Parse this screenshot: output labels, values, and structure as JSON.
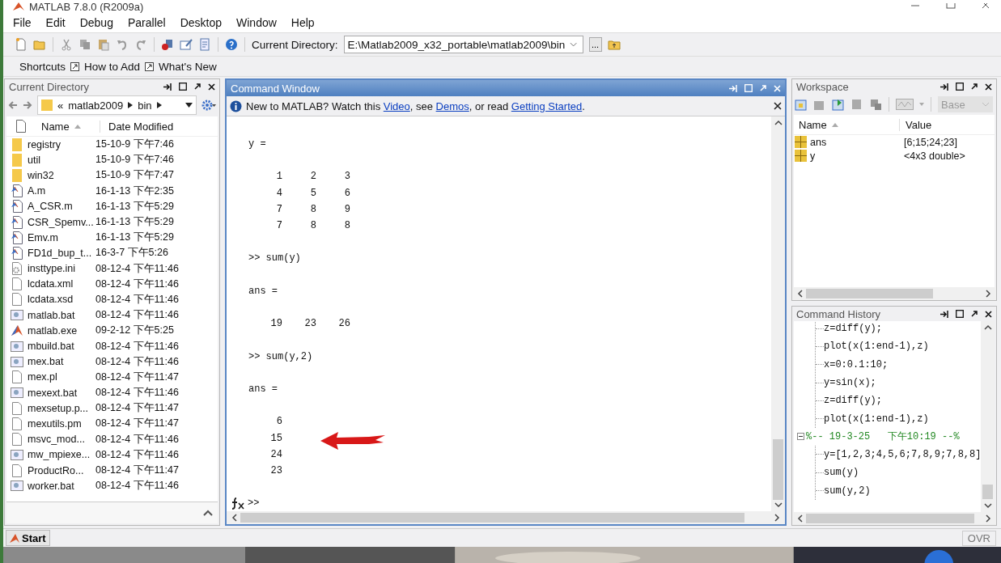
{
  "window": {
    "title": "MATLAB 7.8.0 (R2009a)"
  },
  "menu": [
    "File",
    "Edit",
    "Debug",
    "Parallel",
    "Desktop",
    "Window",
    "Help"
  ],
  "toolbar": {
    "directory_label": "Current Directory:",
    "directory": "E:\\Matlab2009_x32_portable\\matlab2009\\bin",
    "browse": "..."
  },
  "shortcuts": [
    "Shortcuts",
    "How to Add",
    "What's New"
  ],
  "current_directory": {
    "title": "Current Directory",
    "path": [
      "«",
      "matlab2009",
      "bin"
    ],
    "columns": [
      "Name",
      "Date Modified"
    ],
    "files": [
      {
        "name": "registry",
        "date": "15-10-9 下午7:46",
        "kind": "folder"
      },
      {
        "name": "util",
        "date": "15-10-9 下午7:46",
        "kind": "folder"
      },
      {
        "name": "win32",
        "date": "15-10-9 下午7:47",
        "kind": "folder"
      },
      {
        "name": "A.m",
        "date": "16-1-13 下午2:35",
        "kind": "mfile"
      },
      {
        "name": "A_CSR.m",
        "date": "16-1-13 下午5:29",
        "kind": "mfile"
      },
      {
        "name": "CSR_Spemv...",
        "date": "16-1-13 下午5:29",
        "kind": "mfile"
      },
      {
        "name": "Emv.m",
        "date": "16-1-13 下午5:29",
        "kind": "mfile"
      },
      {
        "name": "FD1d_bup_t...",
        "date": "16-3-7 下午5:26",
        "kind": "mfile"
      },
      {
        "name": "insttype.ini",
        "date": "08-12-4 下午11:46",
        "kind": "config"
      },
      {
        "name": "lcdata.xml",
        "date": "08-12-4 下午11:46",
        "kind": "file"
      },
      {
        "name": "lcdata.xsd",
        "date": "08-12-4 下午11:46",
        "kind": "file"
      },
      {
        "name": "matlab.bat",
        "date": "08-12-4 下午11:46",
        "kind": "batch"
      },
      {
        "name": "matlab.exe",
        "date": "09-2-12 下午5:25",
        "kind": "exe"
      },
      {
        "name": "mbuild.bat",
        "date": "08-12-4 下午11:46",
        "kind": "batch"
      },
      {
        "name": "mex.bat",
        "date": "08-12-4 下午11:46",
        "kind": "batch"
      },
      {
        "name": "mex.pl",
        "date": "08-12-4 下午11:47",
        "kind": "file"
      },
      {
        "name": "mexext.bat",
        "date": "08-12-4 下午11:46",
        "kind": "batch"
      },
      {
        "name": "mexsetup.p...",
        "date": "08-12-4 下午11:47",
        "kind": "file"
      },
      {
        "name": "mexutils.pm",
        "date": "08-12-4 下午11:47",
        "kind": "file"
      },
      {
        "name": "msvc_mod...",
        "date": "08-12-4 下午11:46",
        "kind": "file"
      },
      {
        "name": "mw_mpiexe...",
        "date": "08-12-4 下午11:46",
        "kind": "batch"
      },
      {
        "name": "ProductRo...",
        "date": "08-12-4 下午11:47",
        "kind": "file"
      },
      {
        "name": "worker.bat",
        "date": "08-12-4 下午11:46",
        "kind": "batch"
      }
    ]
  },
  "command_window": {
    "title": "Command Window",
    "info": [
      {
        "text": "New to MATLAB? Watch this ",
        "link": false
      },
      {
        "text": "Video",
        "link": true
      },
      {
        "text": ", see ",
        "link": false
      },
      {
        "text": "Demos",
        "link": true
      },
      {
        "text": ", or read ",
        "link": false
      },
      {
        "text": "Getting Started",
        "link": true
      },
      {
        "text": ".",
        "link": false
      }
    ],
    "output": [
      {
        "kind": "label",
        "text": "y ="
      },
      {
        "kind": "matrix",
        "rows": [
          [
            "1",
            "2",
            "3"
          ],
          [
            "4",
            "5",
            "6"
          ],
          [
            "7",
            "8",
            "9"
          ],
          [
            "7",
            "8",
            "8"
          ]
        ]
      },
      {
        "kind": "command",
        "text": ">> sum(y)"
      },
      {
        "kind": "label",
        "text": "ans ="
      },
      {
        "kind": "matrix",
        "rows": [
          [
            "19",
            "23",
            "26"
          ]
        ]
      },
      {
        "kind": "command",
        "text": ">> sum(y,2)"
      },
      {
        "kind": "label",
        "text": "ans ="
      },
      {
        "kind": "matrix",
        "rows": [
          [
            "6"
          ],
          [
            "15"
          ],
          [
            "24"
          ],
          [
            "23"
          ]
        ]
      }
    ],
    "prompt": ">>"
  },
  "workspace": {
    "title": "Workspace",
    "stack": "Base",
    "columns": [
      "Name",
      "Value"
    ],
    "variables": [
      {
        "name": "ans",
        "value": "[6;15;24;23]"
      },
      {
        "name": "y",
        "value": "<4x3 double>"
      }
    ]
  },
  "command_history": {
    "title": "Command History",
    "sessions": [
      {
        "entries": [
          "z=diff(y);",
          "plot(x(1:end-1),z)",
          "x=0:0.1:10;",
          "y=sin(x);",
          "z=diff(y);",
          "plot(x(1:end-1),z)"
        ]
      },
      {
        "header": "%-- 19-3-25   下午10:19 --%",
        "expanded": true,
        "entries": [
          "y=[1,2,3;4,5,6;7,8,9;7,8,8]",
          "sum(y)",
          "sum(y,2)"
        ]
      }
    ]
  },
  "status_bar": {
    "start": "Start",
    "mode": "OVR"
  }
}
